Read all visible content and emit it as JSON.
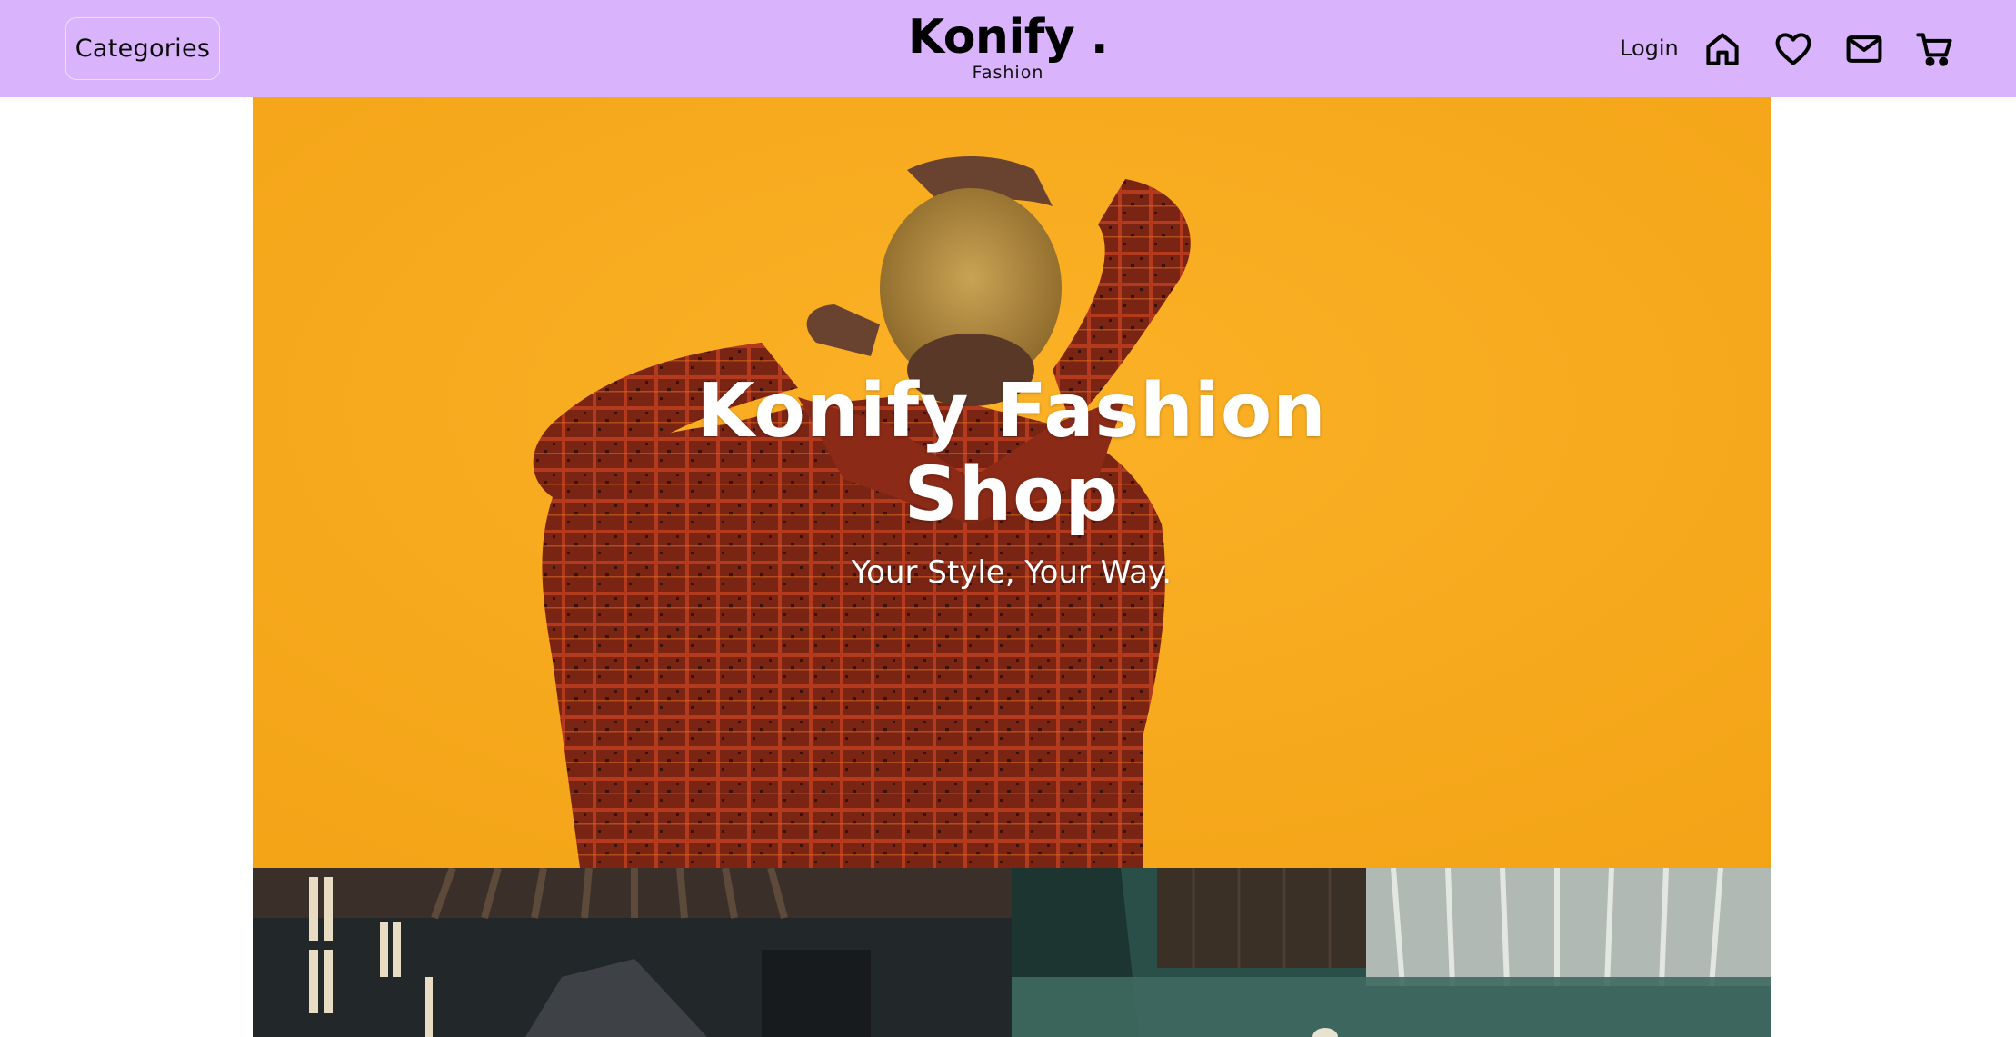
{
  "header": {
    "categories_label": "Categories",
    "logo_title": "Konify .",
    "logo_subtitle": "Fashion",
    "login_label": "Login",
    "icons": [
      "home-icon",
      "heart-icon",
      "mail-icon",
      "cart-icon"
    ],
    "background_color": "#d9b3fc"
  },
  "hero": {
    "title": "Konify Fashion Shop",
    "tagline": "Your Style, Your Way.",
    "background_color": "#f8a81a",
    "image": "person-in-plaid-shirt-against-orange-wall"
  },
  "gallery": {
    "images": [
      "dark-loft-interior",
      "green-carpet-room-with-curtains"
    ]
  }
}
